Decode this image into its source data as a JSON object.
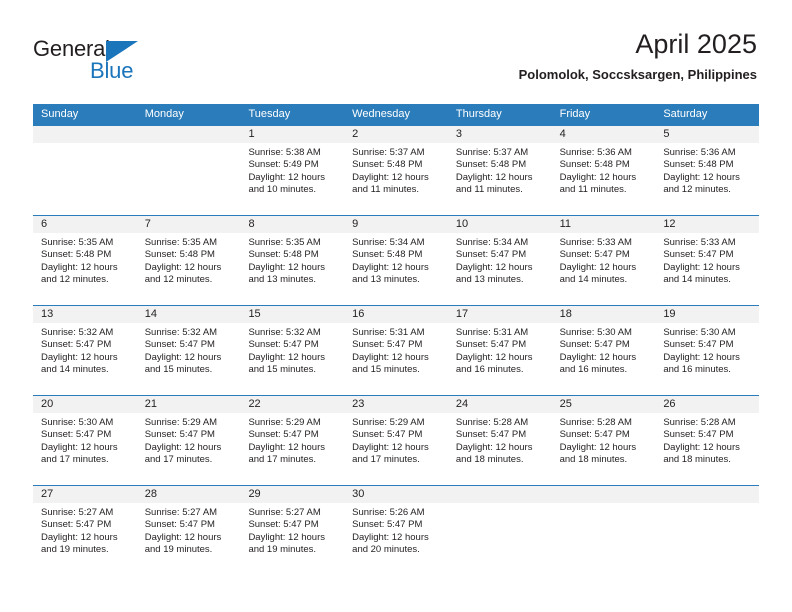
{
  "brand": {
    "name_line1": "General",
    "name_line2": "Blue",
    "accent_color": "#1b75bb"
  },
  "header": {
    "title": "April 2025",
    "subtitle": "Polomolok, Soccsksargen, Philippines"
  },
  "calendar": {
    "header_color": "#2b7cba",
    "weekdays": [
      "Sunday",
      "Monday",
      "Tuesday",
      "Wednesday",
      "Thursday",
      "Friday",
      "Saturday"
    ],
    "weeks": [
      [
        {
          "day": "",
          "sunrise": "",
          "sunset": "",
          "daylight1": "",
          "daylight2": ""
        },
        {
          "day": "",
          "sunrise": "",
          "sunset": "",
          "daylight1": "",
          "daylight2": ""
        },
        {
          "day": "1",
          "sunrise": "Sunrise: 5:38 AM",
          "sunset": "Sunset: 5:49 PM",
          "daylight1": "Daylight: 12 hours",
          "daylight2": "and 10 minutes."
        },
        {
          "day": "2",
          "sunrise": "Sunrise: 5:37 AM",
          "sunset": "Sunset: 5:48 PM",
          "daylight1": "Daylight: 12 hours",
          "daylight2": "and 11 minutes."
        },
        {
          "day": "3",
          "sunrise": "Sunrise: 5:37 AM",
          "sunset": "Sunset: 5:48 PM",
          "daylight1": "Daylight: 12 hours",
          "daylight2": "and 11 minutes."
        },
        {
          "day": "4",
          "sunrise": "Sunrise: 5:36 AM",
          "sunset": "Sunset: 5:48 PM",
          "daylight1": "Daylight: 12 hours",
          "daylight2": "and 11 minutes."
        },
        {
          "day": "5",
          "sunrise": "Sunrise: 5:36 AM",
          "sunset": "Sunset: 5:48 PM",
          "daylight1": "Daylight: 12 hours",
          "daylight2": "and 12 minutes."
        }
      ],
      [
        {
          "day": "6",
          "sunrise": "Sunrise: 5:35 AM",
          "sunset": "Sunset: 5:48 PM",
          "daylight1": "Daylight: 12 hours",
          "daylight2": "and 12 minutes."
        },
        {
          "day": "7",
          "sunrise": "Sunrise: 5:35 AM",
          "sunset": "Sunset: 5:48 PM",
          "daylight1": "Daylight: 12 hours",
          "daylight2": "and 12 minutes."
        },
        {
          "day": "8",
          "sunrise": "Sunrise: 5:35 AM",
          "sunset": "Sunset: 5:48 PM",
          "daylight1": "Daylight: 12 hours",
          "daylight2": "and 13 minutes."
        },
        {
          "day": "9",
          "sunrise": "Sunrise: 5:34 AM",
          "sunset": "Sunset: 5:48 PM",
          "daylight1": "Daylight: 12 hours",
          "daylight2": "and 13 minutes."
        },
        {
          "day": "10",
          "sunrise": "Sunrise: 5:34 AM",
          "sunset": "Sunset: 5:47 PM",
          "daylight1": "Daylight: 12 hours",
          "daylight2": "and 13 minutes."
        },
        {
          "day": "11",
          "sunrise": "Sunrise: 5:33 AM",
          "sunset": "Sunset: 5:47 PM",
          "daylight1": "Daylight: 12 hours",
          "daylight2": "and 14 minutes."
        },
        {
          "day": "12",
          "sunrise": "Sunrise: 5:33 AM",
          "sunset": "Sunset: 5:47 PM",
          "daylight1": "Daylight: 12 hours",
          "daylight2": "and 14 minutes."
        }
      ],
      [
        {
          "day": "13",
          "sunrise": "Sunrise: 5:32 AM",
          "sunset": "Sunset: 5:47 PM",
          "daylight1": "Daylight: 12 hours",
          "daylight2": "and 14 minutes."
        },
        {
          "day": "14",
          "sunrise": "Sunrise: 5:32 AM",
          "sunset": "Sunset: 5:47 PM",
          "daylight1": "Daylight: 12 hours",
          "daylight2": "and 15 minutes."
        },
        {
          "day": "15",
          "sunrise": "Sunrise: 5:32 AM",
          "sunset": "Sunset: 5:47 PM",
          "daylight1": "Daylight: 12 hours",
          "daylight2": "and 15 minutes."
        },
        {
          "day": "16",
          "sunrise": "Sunrise: 5:31 AM",
          "sunset": "Sunset: 5:47 PM",
          "daylight1": "Daylight: 12 hours",
          "daylight2": "and 15 minutes."
        },
        {
          "day": "17",
          "sunrise": "Sunrise: 5:31 AM",
          "sunset": "Sunset: 5:47 PM",
          "daylight1": "Daylight: 12 hours",
          "daylight2": "and 16 minutes."
        },
        {
          "day": "18",
          "sunrise": "Sunrise: 5:30 AM",
          "sunset": "Sunset: 5:47 PM",
          "daylight1": "Daylight: 12 hours",
          "daylight2": "and 16 minutes."
        },
        {
          "day": "19",
          "sunrise": "Sunrise: 5:30 AM",
          "sunset": "Sunset: 5:47 PM",
          "daylight1": "Daylight: 12 hours",
          "daylight2": "and 16 minutes."
        }
      ],
      [
        {
          "day": "20",
          "sunrise": "Sunrise: 5:30 AM",
          "sunset": "Sunset: 5:47 PM",
          "daylight1": "Daylight: 12 hours",
          "daylight2": "and 17 minutes."
        },
        {
          "day": "21",
          "sunrise": "Sunrise: 5:29 AM",
          "sunset": "Sunset: 5:47 PM",
          "daylight1": "Daylight: 12 hours",
          "daylight2": "and 17 minutes."
        },
        {
          "day": "22",
          "sunrise": "Sunrise: 5:29 AM",
          "sunset": "Sunset: 5:47 PM",
          "daylight1": "Daylight: 12 hours",
          "daylight2": "and 17 minutes."
        },
        {
          "day": "23",
          "sunrise": "Sunrise: 5:29 AM",
          "sunset": "Sunset: 5:47 PM",
          "daylight1": "Daylight: 12 hours",
          "daylight2": "and 17 minutes."
        },
        {
          "day": "24",
          "sunrise": "Sunrise: 5:28 AM",
          "sunset": "Sunset: 5:47 PM",
          "daylight1": "Daylight: 12 hours",
          "daylight2": "and 18 minutes."
        },
        {
          "day": "25",
          "sunrise": "Sunrise: 5:28 AM",
          "sunset": "Sunset: 5:47 PM",
          "daylight1": "Daylight: 12 hours",
          "daylight2": "and 18 minutes."
        },
        {
          "day": "26",
          "sunrise": "Sunrise: 5:28 AM",
          "sunset": "Sunset: 5:47 PM",
          "daylight1": "Daylight: 12 hours",
          "daylight2": "and 18 minutes."
        }
      ],
      [
        {
          "day": "27",
          "sunrise": "Sunrise: 5:27 AM",
          "sunset": "Sunset: 5:47 PM",
          "daylight1": "Daylight: 12 hours",
          "daylight2": "and 19 minutes."
        },
        {
          "day": "28",
          "sunrise": "Sunrise: 5:27 AM",
          "sunset": "Sunset: 5:47 PM",
          "daylight1": "Daylight: 12 hours",
          "daylight2": "and 19 minutes."
        },
        {
          "day": "29",
          "sunrise": "Sunrise: 5:27 AM",
          "sunset": "Sunset: 5:47 PM",
          "daylight1": "Daylight: 12 hours",
          "daylight2": "and 19 minutes."
        },
        {
          "day": "30",
          "sunrise": "Sunrise: 5:26 AM",
          "sunset": "Sunset: 5:47 PM",
          "daylight1": "Daylight: 12 hours",
          "daylight2": "and 20 minutes."
        },
        {
          "day": "",
          "sunrise": "",
          "sunset": "",
          "daylight1": "",
          "daylight2": ""
        },
        {
          "day": "",
          "sunrise": "",
          "sunset": "",
          "daylight1": "",
          "daylight2": ""
        },
        {
          "day": "",
          "sunrise": "",
          "sunset": "",
          "daylight1": "",
          "daylight2": ""
        }
      ]
    ]
  }
}
